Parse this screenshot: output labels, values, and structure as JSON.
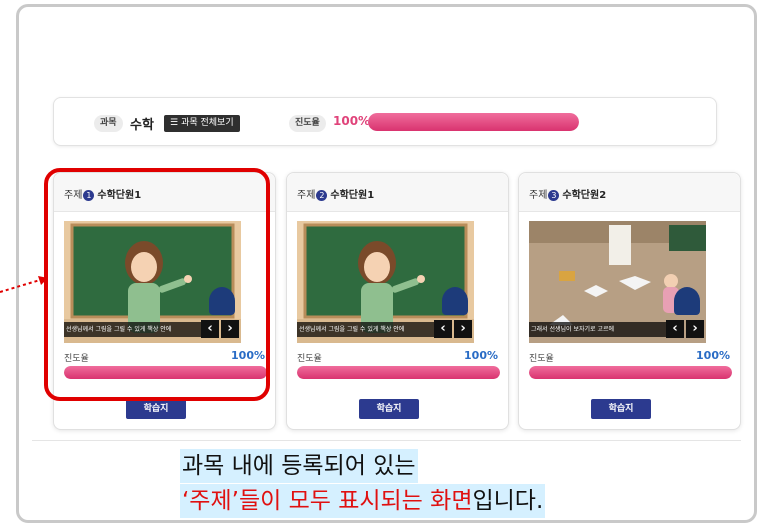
{
  "header": {
    "subject_label": "과목",
    "subject_value": "수학",
    "view_all_label": "과목 전체보기",
    "progress_label": "진도율",
    "progress_value": "100%",
    "progress_fraction": 1.0
  },
  "cards": [
    {
      "topic_label": "주제",
      "number": "1",
      "title": "수학단원1",
      "subtitle": "선생님께서 그림을 그릴 수 있게 책상 안에",
      "progress_label": "진도율",
      "progress_value": "100%",
      "progress_fraction": 1.0,
      "button_label": "학습지"
    },
    {
      "topic_label": "주제",
      "number": "2",
      "title": "수학단원1",
      "subtitle": "선생님께서 그림을 그릴 수 있게 책상 안에",
      "progress_label": "진도율",
      "progress_value": "100%",
      "progress_fraction": 1.0,
      "button_label": "학습지"
    },
    {
      "topic_label": "주제",
      "number": "3",
      "title": "수학단원2",
      "subtitle": "그래서 선생님이 보자기로 고르에",
      "progress_label": "진도율",
      "progress_value": "100%",
      "progress_fraction": 1.0,
      "button_label": "학습지"
    }
  ],
  "caption": {
    "line1": "과목 내에 등록되어 있는",
    "line2_red": "‘주제’들이 모두 표시되는 화면",
    "line2_black": "입니다."
  },
  "colors": {
    "accent_pink": "#e0437a",
    "navy": "#2c3a8f",
    "highlight_red": "#e00000",
    "caption_bg": "#d5f0ff",
    "chalkboard": "#2f6b3f"
  }
}
